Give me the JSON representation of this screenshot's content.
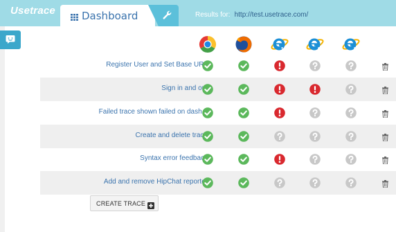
{
  "app": {
    "logo": "Usetrace"
  },
  "nav": {
    "tab_label": "Dashboard",
    "results_label": "Results for:",
    "results_url": "http://test.usetrace.com/"
  },
  "browsers": [
    {
      "name": "chrome-icon"
    },
    {
      "name": "firefox-icon"
    },
    {
      "name": "ie10-icon",
      "version": "10"
    },
    {
      "name": "ie9-icon",
      "version": "9"
    },
    {
      "name": "ie8-icon",
      "version": "8"
    }
  ],
  "colors": {
    "pass": "#5cb85c",
    "fail": "#d9292f",
    "unknown": "#c8c8c8",
    "accent": "#3a73ad",
    "topbar": "#9fdbe6"
  },
  "traces": [
    {
      "name": "Register User and Set Base URL",
      "results": [
        "pass",
        "pass",
        "fail",
        "unknown",
        "unknown"
      ]
    },
    {
      "name": "Sign in and out",
      "results": [
        "pass",
        "pass",
        "fail",
        "fail",
        "unknown"
      ]
    },
    {
      "name": "Failed trace shown failed on dash...",
      "results": [
        "pass",
        "pass",
        "fail",
        "unknown",
        "unknown"
      ]
    },
    {
      "name": "Create and delete trace",
      "results": [
        "pass",
        "pass",
        "unknown",
        "unknown",
        "unknown"
      ]
    },
    {
      "name": "Syntax error feedback",
      "results": [
        "pass",
        "pass",
        "fail",
        "unknown",
        "unknown"
      ]
    },
    {
      "name": "Add and remove HipChat reporter",
      "results": [
        "pass",
        "pass",
        "unknown",
        "unknown",
        "unknown"
      ]
    }
  ],
  "actions": {
    "create_trace": "CREATE TRACE"
  }
}
